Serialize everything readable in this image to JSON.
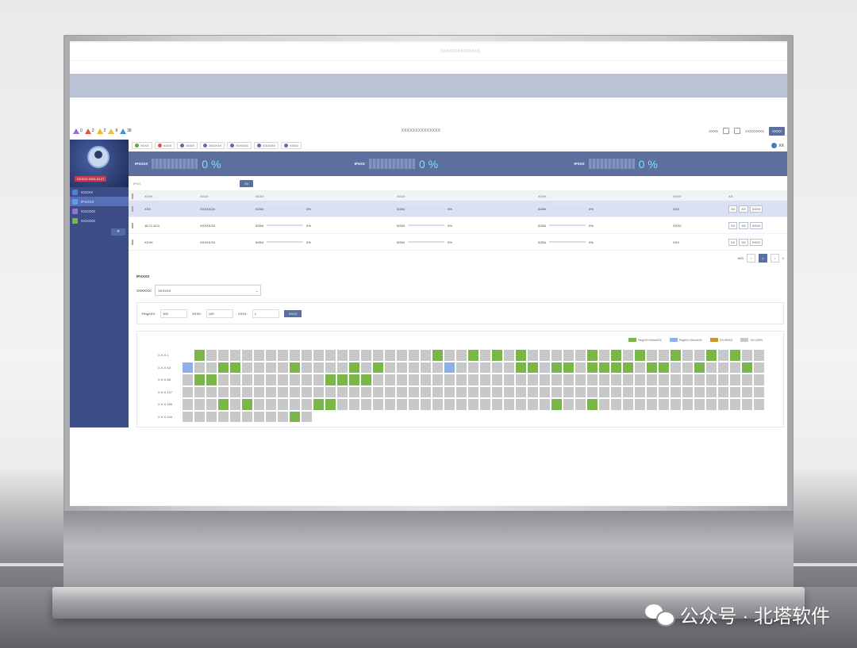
{
  "app": {
    "title": "XXXXXXXXXXXXXX",
    "warnings": [
      {
        "count": "0",
        "color": "#8a6fd8"
      },
      {
        "count": "2",
        "color": "#e0534b"
      },
      {
        "count": "2",
        "color": "#f0b429"
      },
      {
        "count": "8",
        "color": "#e8c33a"
      },
      {
        "count": "38",
        "color": "#4a90d9"
      }
    ],
    "header_links": [
      "XXXX",
      "XXXXXXXX"
    ],
    "header_button": "XXXX"
  },
  "sidebar": {
    "user_label": "XXXXX 2024.10.27",
    "items": [
      {
        "label": "XXXXX",
        "color": "#4f7fd6"
      },
      {
        "label": "IPXXXX",
        "color": "#5aa0e6"
      },
      {
        "label": "XXXXXX",
        "color": "#9b6be0"
      },
      {
        "label": "XXXXXX",
        "color": "#6fbf3b"
      }
    ],
    "collapse_glyph": "«"
  },
  "tabs": [
    {
      "label": "XXXX",
      "color": "#5fa83b"
    },
    {
      "label": "XXXX",
      "color": "#e0534b"
    },
    {
      "label": "XXXX",
      "color": "#5b6fa0"
    },
    {
      "label": "XXXXXX",
      "color": "#5b6fa0"
    },
    {
      "label": "XXXXXX",
      "color": "#5b6fa0"
    },
    {
      "label": "XXXXXX",
      "color": "#5b6fa0"
    },
    {
      "label": "XXXX",
      "color": "#5b6fa0"
    }
  ],
  "help_label": "XX",
  "stats": [
    {
      "label": "IPXXXX",
      "value": "0 %"
    },
    {
      "label": "IPXXX",
      "value": "0 %"
    },
    {
      "label": "IPXXX",
      "value": "0 %"
    }
  ],
  "search": {
    "placeholder": "IPXX",
    "button": "XX"
  },
  "table": {
    "headers": [
      "XXXX",
      "XXXX",
      "XXXX",
      "XXXX",
      "XXXX",
      "XXXX",
      "XX"
    ],
    "rows": [
      {
        "name": "XXX",
        "subnet": "XXXXX/24",
        "a": "0/254",
        "b": "0/254",
        "c": "0/254",
        "ap": "0%",
        "bp": "0%",
        "cp": "0%",
        "dept": "XXX",
        "selected": true,
        "progress": 0
      },
      {
        "name": "16.71.10.0",
        "subnet": "XXXXX/24",
        "a": "0/254",
        "b": "0/254",
        "c": "0/254",
        "ap": "0%",
        "bp": "0%",
        "cp": "0%",
        "dept": "XXXX",
        "selected": false,
        "progress": 0
      },
      {
        "name": "XXXX",
        "subnet": "XXXXX/24",
        "a": "0/254",
        "b": "0/254",
        "c": "0/254",
        "ap": "0%",
        "bp": "0%",
        "cp": "0%",
        "dept": "XXX",
        "selected": false,
        "progress": 0
      }
    ],
    "actions": [
      "XX",
      "XX",
      "XXXX"
    ]
  },
  "pager": {
    "total": "XX3",
    "current": "1",
    "size": "1"
  },
  "ip_section": {
    "title": "IPXXXX",
    "select_label": "XXXXXX:",
    "select_value": "XXXXXX",
    "params": [
      {
        "label": "PingXXX:",
        "value": "100"
      },
      {
        "label": "XXXX:",
        "value": "100"
      },
      {
        "label": "XXXX:",
        "value": "1"
      }
    ],
    "param_button": "XXXX",
    "legend": [
      {
        "label": "PingXX<10msXXX",
        "color": "#7ab648"
      },
      {
        "label": "PingXX>10msXXX",
        "color": "#8fb0e6"
      },
      {
        "label": "XX<5%XX",
        "color": "#c19a2e"
      },
      {
        "label": "XX=100%",
        "color": "#c8c8c8"
      }
    ],
    "row_labels": [
      "X.X.X.1",
      "X.X.X.43",
      "X.X.X.86",
      "X.X.X.127",
      "X.X.X.169",
      "X.X.X.244"
    ]
  },
  "watermark": "公众号 · 北塔软件"
}
